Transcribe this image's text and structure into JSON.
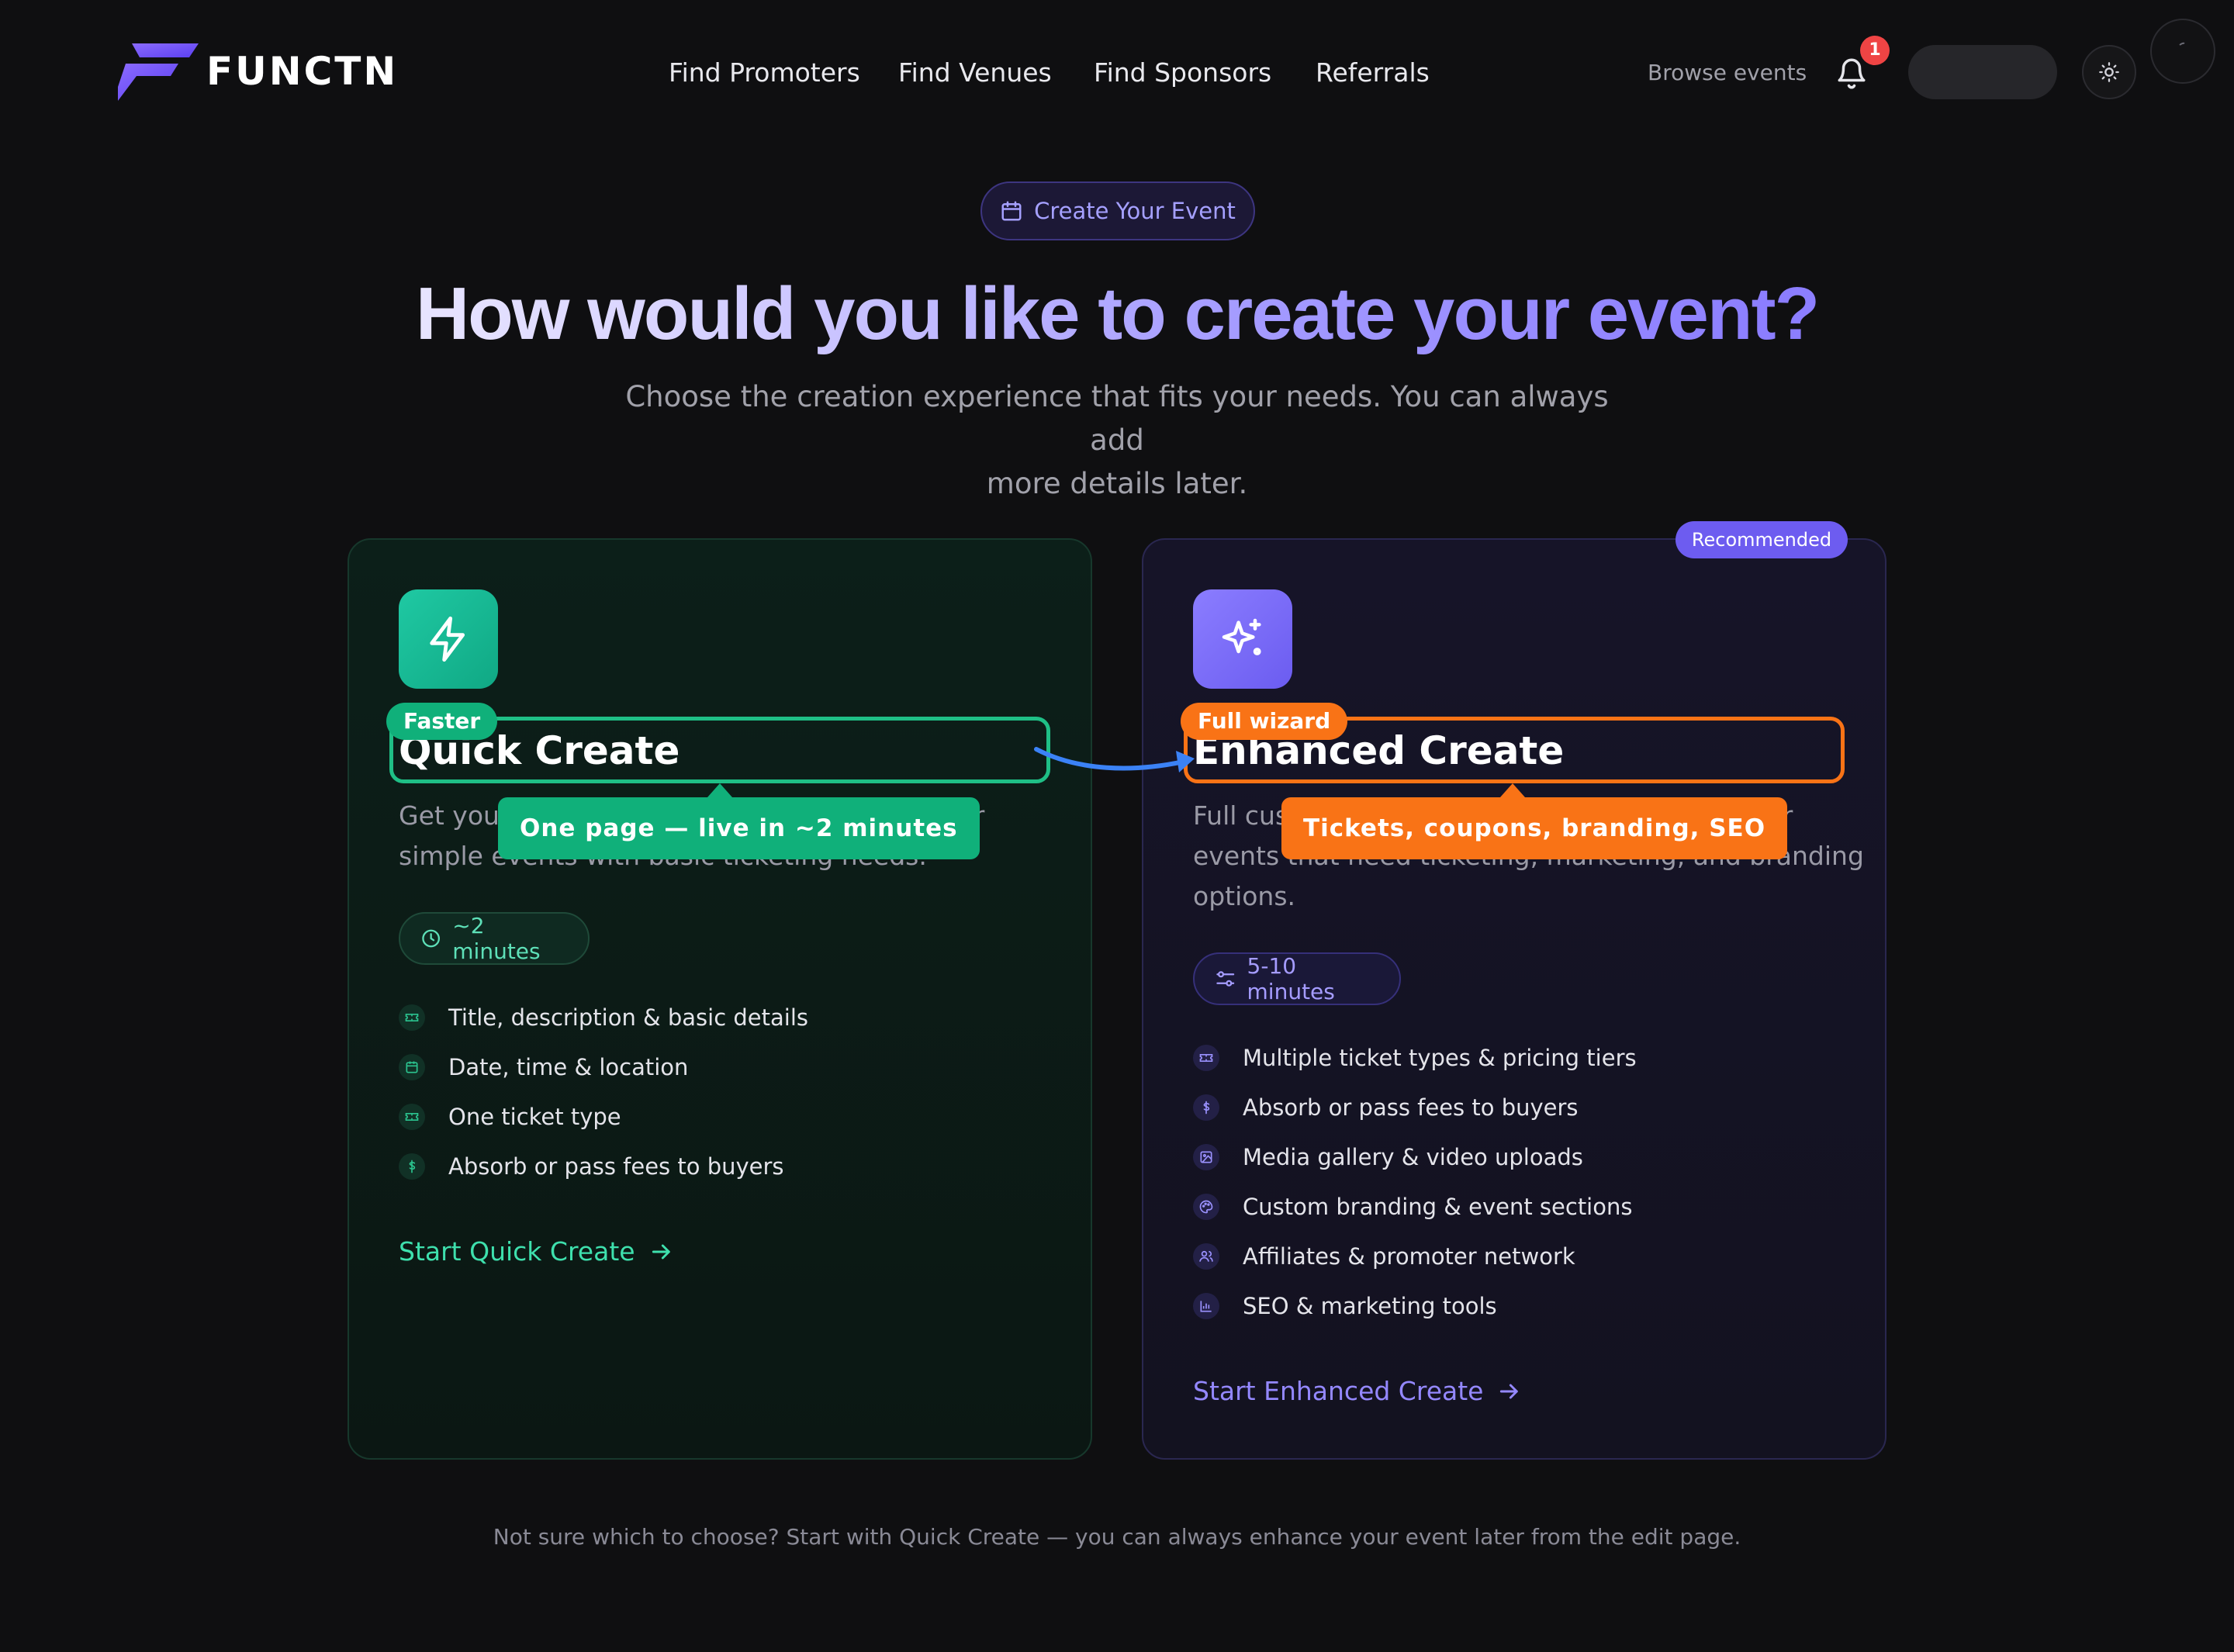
{
  "header": {
    "brand": "FUNCTN",
    "nav": [
      "Find Promoters",
      "Find Venues",
      "Find Sponsors",
      "Referrals"
    ],
    "browse_events": "Browse events",
    "notification_count": "1"
  },
  "hero": {
    "pill_label": "Create Your Event",
    "title": "How would you like to create your event?",
    "subtitle_line1": "Choose the creation experience that fits your needs. You can always add",
    "subtitle_line2": "more details later."
  },
  "quick": {
    "title": "Quick Create",
    "desc_line1_a": "Get your",
    "desc_line1_b": "for",
    "desc_line2": "simple events with basic ticketing needs.",
    "time": "~2 minutes",
    "features": [
      {
        "icon": "ticket-icon",
        "label": "Title, description & basic details"
      },
      {
        "icon": "calendar-icon",
        "label": "Date, time & location"
      },
      {
        "icon": "ticket-icon",
        "label": "One ticket type"
      },
      {
        "icon": "dollar-icon",
        "label": "Absorb or pass fees to buyers"
      }
    ],
    "cta": "Start Quick Create",
    "tag": "Faster",
    "callout": "One page — live in ~2 minutes"
  },
  "enhanced": {
    "badge": "Recommended",
    "title": "Enhanced Create",
    "desc_line1_a": "Full cus",
    "desc_line1_b": "for",
    "desc_line2": "events that need ticketing, marketing, and branding",
    "desc_line3": "options.",
    "time": "5-10 minutes",
    "features": [
      {
        "icon": "ticket-icon",
        "label": "Multiple ticket types & pricing tiers"
      },
      {
        "icon": "dollar-icon",
        "label": "Absorb or pass fees to buyers"
      },
      {
        "icon": "image-icon",
        "label": "Media gallery & video uploads"
      },
      {
        "icon": "palette-icon",
        "label": "Custom branding & event sections"
      },
      {
        "icon": "users-icon",
        "label": "Affiliates & promoter network"
      },
      {
        "icon": "chart-icon",
        "label": "SEO & marketing tools"
      }
    ],
    "cta": "Start Enhanced Create",
    "tag": "Full wizard",
    "callout": "Tickets, coupons, branding, SEO"
  },
  "footer_note": "Not sure which to choose? Start with Quick Create — you can always enhance your event later from the edit page.",
  "colors": {
    "background": "#0f0f11",
    "accent_green": "#10b07a",
    "accent_purple": "#6d5cf0",
    "accent_orange": "#f97316",
    "arrow_blue": "#3b82f6",
    "notification": "#ef4444"
  }
}
